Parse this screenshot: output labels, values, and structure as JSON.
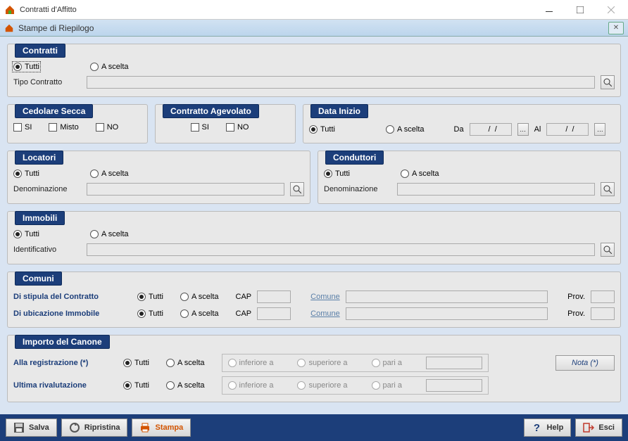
{
  "window": {
    "title": "Contratti d'Affitto"
  },
  "subwindow": {
    "title": "Stampe di Riepilogo"
  },
  "contratti": {
    "legend": "Contratti",
    "tutti": "Tutti",
    "ascelta": "A scelta",
    "tipo_label": "Tipo Contratto",
    "tipo_value": ""
  },
  "cedolare": {
    "legend": "Cedolare Secca",
    "si": "SI",
    "misto": "Misto",
    "no": "NO"
  },
  "agevolato": {
    "legend": "Contratto Agevolato",
    "si": "SI",
    "no": "NO"
  },
  "data_inizio": {
    "legend": "Data Inizio",
    "tutti": "Tutti",
    "ascelta": "A scelta",
    "da": "Da",
    "al": "Al",
    "da_value": "  /  /",
    "al_value": "  /  /"
  },
  "locatori": {
    "legend": "Locatori",
    "tutti": "Tutti",
    "ascelta": "A scelta",
    "denom_label": "Denominazione",
    "denom_value": ""
  },
  "conduttori": {
    "legend": "Conduttori",
    "tutti": "Tutti",
    "ascelta": "A scelta",
    "denom_label": "Denominazione",
    "denom_value": ""
  },
  "immobili": {
    "legend": "Immobili",
    "tutti": "Tutti",
    "ascelta": "A scelta",
    "ident_label": "Identificativo",
    "ident_value": ""
  },
  "comuni": {
    "legend": "Comuni",
    "stipula_label": "Di stipula del Contratto",
    "ubicazione_label": "Di ubicazione Immobile",
    "tutti": "Tutti",
    "ascelta": "A scelta",
    "cap": "CAP",
    "comune": "Comune",
    "prov": "Prov."
  },
  "canone": {
    "legend": "Importo del Canone",
    "reg_label": "Alla registrazione (*)",
    "riv_label": "Ultima rivalutazione",
    "tutti": "Tutti",
    "ascelta": "A scelta",
    "inferiore": "inferiore a",
    "superiore": "superiore a",
    "pari": "pari a",
    "nota": "Nota (*)"
  },
  "footer": {
    "salva": "Salva",
    "ripristina": "Ripristina",
    "stampa": "Stampa",
    "help": "Help",
    "esci": "Esci"
  }
}
